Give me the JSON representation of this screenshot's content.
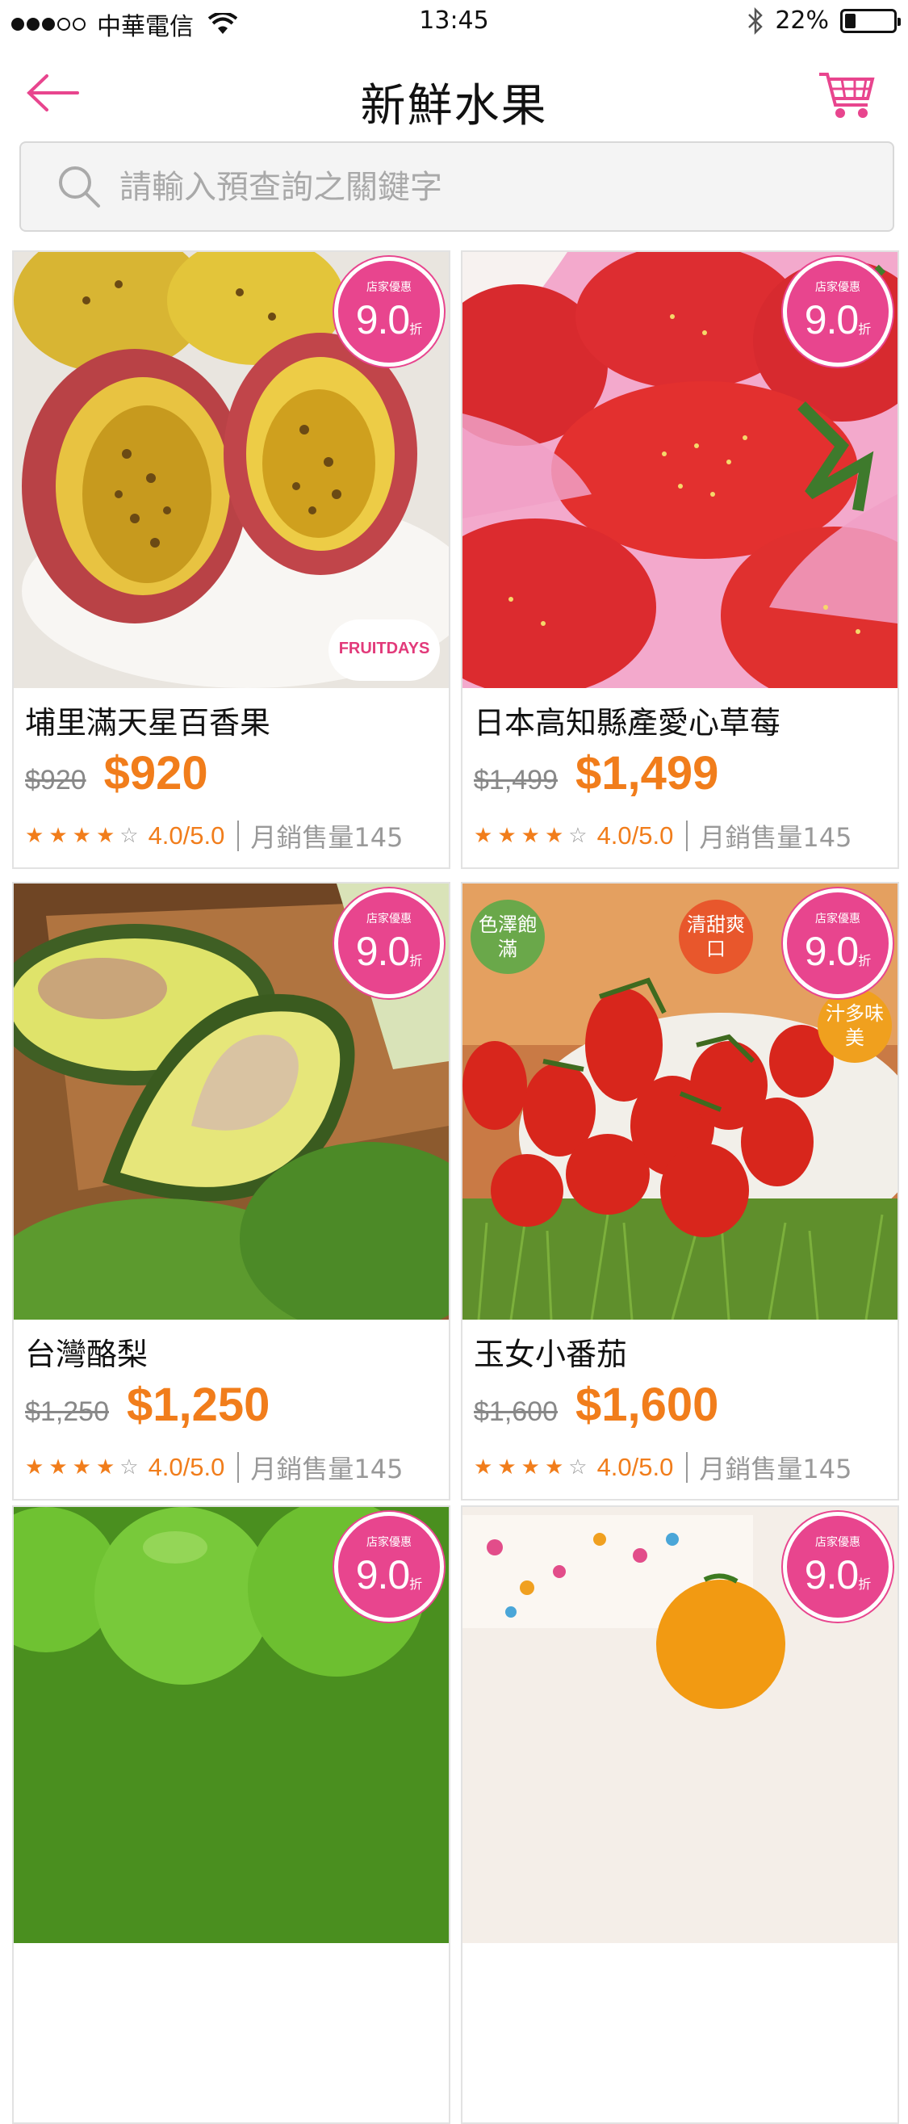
{
  "status_bar": {
    "carrier": "中華電信",
    "time": "13:45",
    "battery": "22%",
    "battery_level": 0.22,
    "signal_bars": 3,
    "signal_max": 5
  },
  "header": {
    "title": "新鮮水果",
    "back_icon": "arrow-left-icon",
    "cart_icon": "cart-icon",
    "accent_color": "#e8458e"
  },
  "search": {
    "placeholder": "請輸入預查詢之關鍵字"
  },
  "colors": {
    "badge": "#e8458e",
    "price": "#f17d1b",
    "rating": "#f17d1b",
    "muted": "#999999"
  },
  "products": [
    {
      "name": "埔里滿天星百香果",
      "old_price": "$920",
      "price": "$920",
      "badge_top": "店家優惠",
      "badge_value": "9.0",
      "badge_unit": "折",
      "rating_value": 4,
      "rating_text": "4.0/5.0",
      "sales": "月銷售量145",
      "logo_text": "FRUITDAYS"
    },
    {
      "name": "日本高知縣產愛心草莓",
      "old_price": "$1,499",
      "price": "$1,499",
      "badge_top": "店家優惠",
      "badge_value": "9.0",
      "badge_unit": "折",
      "rating_value": 4,
      "rating_text": "4.0/5.0",
      "sales": "月銷售量145"
    },
    {
      "name": "台灣酪梨",
      "old_price": "$1,250",
      "price": "$1,250",
      "badge_top": "店家優惠",
      "badge_value": "9.0",
      "badge_unit": "折",
      "rating_value": 4,
      "rating_text": "4.0/5.0",
      "sales": "月銷售量145"
    },
    {
      "name": "玉女小番茄",
      "old_price": "$1,600",
      "price": "$1,600",
      "badge_top": "店家優惠",
      "badge_value": "9.0",
      "badge_unit": "折",
      "rating_value": 4,
      "rating_text": "4.0/5.0",
      "sales": "月銷售量145",
      "stickers": [
        "色澤飽滿",
        "清甜爽口",
        "汁多味美"
      ]
    },
    {
      "badge_top": "店家優惠",
      "badge_value": "9.0",
      "badge_unit": "折"
    },
    {
      "badge_top": "店家優惠",
      "badge_value": "9.0",
      "badge_unit": "折"
    }
  ]
}
